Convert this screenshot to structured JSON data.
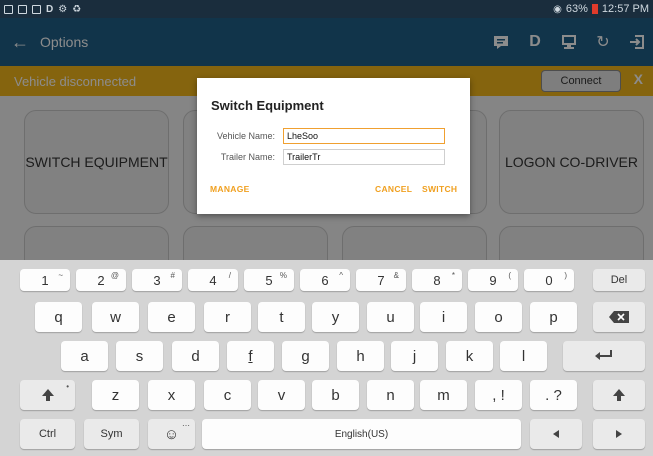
{
  "status_bar": {
    "left_icons": [
      "notification-icon",
      "message-icon",
      "card-icon",
      "d-icon",
      "usb-icon",
      "sync-icon"
    ],
    "battery": "63%",
    "time": "12:57 PM"
  },
  "app_bar": {
    "title": "Options"
  },
  "banner": {
    "text": "Vehicle disconnected",
    "connect_label": "Connect",
    "close_label": "X"
  },
  "tiles": {
    "switch_equipment": "SWITCH EQUIPMENT",
    "logon_co_driver": "LOGON CO-DRIVER"
  },
  "dialog": {
    "title": "Switch Equipment",
    "vehicle_label": "Vehicle Name:",
    "vehicle_value": "LheSoo",
    "trailer_label": "Trailer Name:",
    "trailer_value": "TrailerTr",
    "manage_label": "MANAGE",
    "cancel_label": "CANCEL",
    "switch_label": "SWITCH"
  },
  "keyboard": {
    "row_numbers": [
      {
        "main": "1",
        "sup": "~"
      },
      {
        "main": "2",
        "sup": "@"
      },
      {
        "main": "3",
        "sup": "#"
      },
      {
        "main": "4",
        "sup": "/"
      },
      {
        "main": "5",
        "sup": "%"
      },
      {
        "main": "6",
        "sup": "^"
      },
      {
        "main": "7",
        "sup": "&"
      },
      {
        "main": "8",
        "sup": "*"
      },
      {
        "main": "9",
        "sup": "("
      },
      {
        "main": "0",
        "sup": ")"
      }
    ],
    "del_label": "Del",
    "row1": [
      "q",
      "w",
      "e",
      "r",
      "t",
      "y",
      "u",
      "i",
      "o",
      "p"
    ],
    "row2": [
      "a",
      "s",
      "d",
      "f",
      "g",
      "h",
      "j",
      "k",
      "l"
    ],
    "row3": [
      "z",
      "x",
      "c",
      "v",
      "b",
      "n",
      "m"
    ],
    "comma_key": ", !",
    "period_key": ". ?",
    "ctrl_label": "Ctrl",
    "sym_label": "Sym",
    "space_label": "English(US)"
  },
  "colors": {
    "app_bar": "#1f5f87",
    "banner": "#f3b61b",
    "dialog_accent": "#f0a020"
  }
}
